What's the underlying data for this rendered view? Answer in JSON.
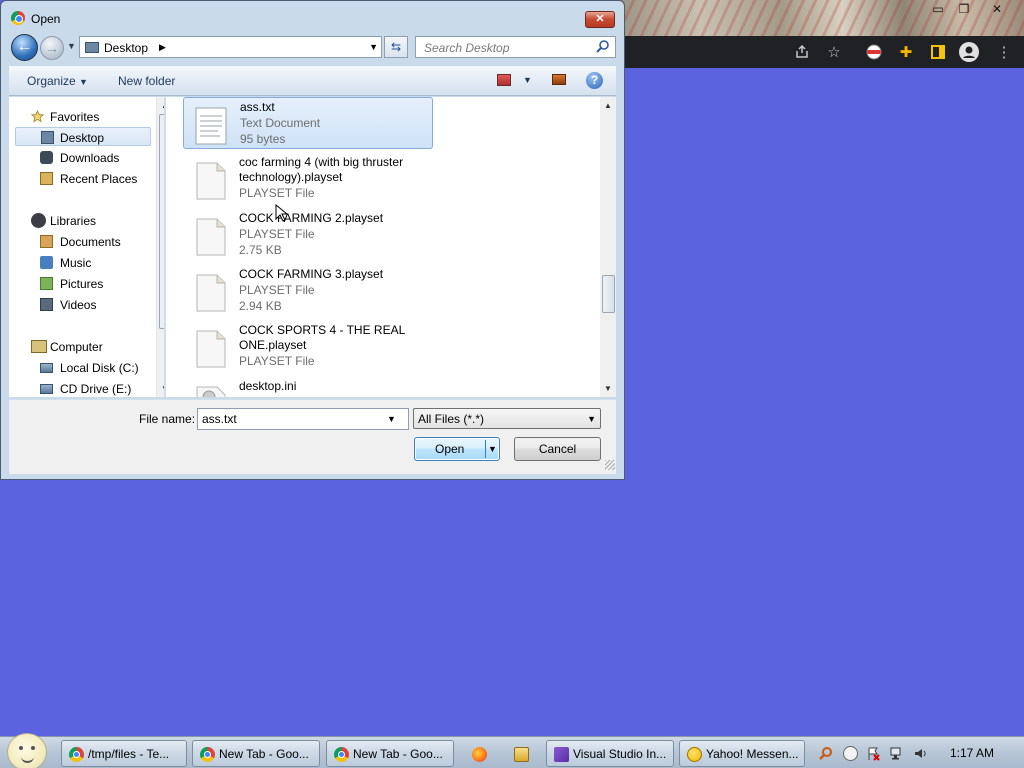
{
  "browser": {
    "controls": {
      "minimize": "▭",
      "restore": "❐",
      "close": "✕"
    },
    "toolbar_icons": [
      "share-icon",
      "star-icon",
      "profile-flag-icon",
      "extensions-icon",
      "sidebar-icon",
      "account-icon",
      "menu-icon"
    ]
  },
  "dialog": {
    "title": "Open",
    "close_label": "✕",
    "address": {
      "location": "Desktop",
      "separator": "▶"
    },
    "search": {
      "placeholder": "Search Desktop"
    },
    "toolbar": {
      "organize": "Organize",
      "new_folder": "New folder"
    },
    "nav": {
      "favorites": "Favorites",
      "desktop": "Desktop",
      "downloads": "Downloads",
      "recent_places": "Recent Places",
      "libraries": "Libraries",
      "documents": "Documents",
      "music": "Music",
      "pictures": "Pictures",
      "videos": "Videos",
      "computer": "Computer",
      "local_disk": "Local Disk (C:)",
      "cd_drive": "CD Drive (E:)"
    },
    "files": [
      {
        "name": "ass.txt",
        "type": "Text Document",
        "size": "95 bytes"
      },
      {
        "name": "coc farming 4 (with big thruster technology).playset",
        "type": "PLAYSET File",
        "size": ""
      },
      {
        "name": "COCK FARMING 2.playset",
        "type": "PLAYSET File",
        "size": "2.75 KB"
      },
      {
        "name": "COCK FARMING 3.playset",
        "type": "PLAYSET File",
        "size": "2.94 KB"
      },
      {
        "name": "COCK SPORTS 4 - THE REAL ONE.playset",
        "type": "PLAYSET File",
        "size": ""
      },
      {
        "name": "desktop.ini",
        "type": "",
        "size": ""
      }
    ],
    "filename_label": "File name:",
    "filename_value": "ass.txt",
    "filetype": "All Files (*.*)",
    "open_label": "Open",
    "cancel_label": "Cancel"
  },
  "taskbar": {
    "buttons": [
      {
        "label": "/tmp/files - Te..."
      },
      {
        "label": "New Tab - Goo..."
      },
      {
        "label": "New Tab - Goo..."
      },
      {
        "label": "Visual Studio In..."
      },
      {
        "label": "Yahoo! Messen..."
      }
    ],
    "clock": "1:17 AM"
  },
  "colors": {
    "desktop": "#5b63de",
    "browser_dark": "#202124",
    "dialog_frame": "#c9daea",
    "selection": "#cfe2f6"
  }
}
